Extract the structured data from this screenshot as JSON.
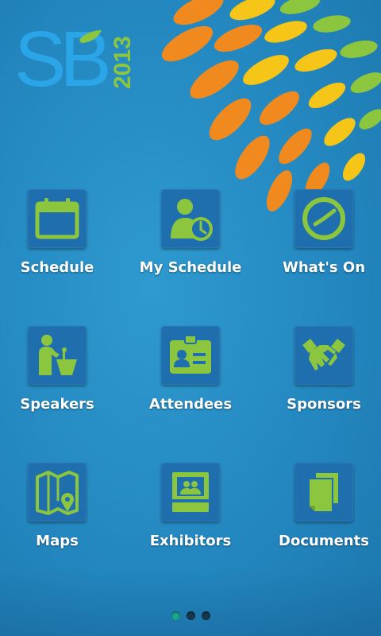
{
  "app": {
    "logo_text": "SB",
    "logo_year": "2013"
  },
  "colors": {
    "background": "#2488c0",
    "tile": "#1f6fae",
    "icon_green": "#8cc63f",
    "petal_orange": "#f08a1e",
    "petal_yellow": "#f5c518",
    "petal_green": "#8cc63f"
  },
  "menu": {
    "items": [
      {
        "label": "Schedule",
        "icon": "calendar-icon"
      },
      {
        "label": "My Schedule",
        "icon": "person-clock-icon"
      },
      {
        "label": "What's On",
        "icon": "clock-icon"
      },
      {
        "label": "Speakers",
        "icon": "speaker-podium-icon"
      },
      {
        "label": "Attendees",
        "icon": "id-badge-icon"
      },
      {
        "label": "Sponsors",
        "icon": "handshake-icon"
      },
      {
        "label": "Maps",
        "icon": "map-pin-icon"
      },
      {
        "label": "Exhibitors",
        "icon": "exhibitor-booth-icon"
      },
      {
        "label": "Documents",
        "icon": "documents-icon"
      }
    ]
  },
  "pager": {
    "pages": 3,
    "current": 1
  }
}
